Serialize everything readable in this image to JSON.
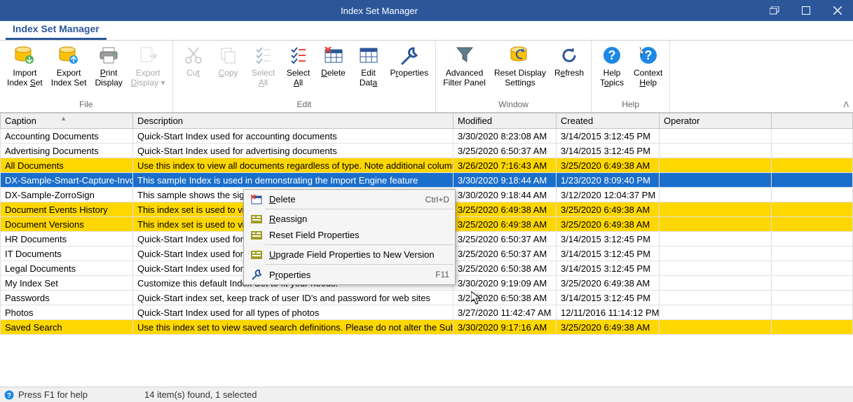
{
  "window": {
    "title": "Index Set Manager"
  },
  "ribbonTab": "Index Set Manager",
  "ribbon": {
    "file": {
      "label": "File",
      "import": "Import\nIndex Set",
      "export": "Export\nIndex Set",
      "print": "Print\nDisplay",
      "exportDisp": "Export\nDisplay ▾"
    },
    "edit": {
      "label": "Edit",
      "cut": "Cut",
      "copy": "Copy",
      "selectAll": "Select\nAll",
      "selectAll2": "Select\nAll",
      "delete": "Delete",
      "editData": "Edit\nData",
      "properties": "Properties"
    },
    "window": {
      "label": "Window",
      "adv": "Advanced\nFilter Panel",
      "reset": "Reset Display\nSettings",
      "refresh": "Refresh"
    },
    "help": {
      "label": "Help",
      "topics": "Help\nTopics",
      "context": "Context\nHelp"
    }
  },
  "columns": {
    "caption": "Caption",
    "description": "Description",
    "modified": "Modified",
    "created": "Created",
    "operator": "Operator"
  },
  "rows": [
    {
      "caption": "Accounting Documents",
      "desc": "Quick-Start Index used for accounting documents",
      "mod": "3/30/2020 8:23:08 AM",
      "created": "3/14/2015 3:12:45 PM",
      "op": "",
      "cls": ""
    },
    {
      "caption": "Advertising Documents",
      "desc": "Quick-Start Index used for advertising documents",
      "mod": "3/25/2020 6:50:37 AM",
      "created": "3/14/2015 3:12:45 PM",
      "op": "",
      "cls": ""
    },
    {
      "caption": "All Documents",
      "desc": "Use this index to view all documents regardless of type. Note additional columns",
      "mod": "3/26/2020 7:16:43 AM",
      "created": "3/25/2020 6:49:38 AM",
      "op": "",
      "cls": "yellow"
    },
    {
      "caption": "DX-Sample-Smart-Capture-Invoice",
      "desc": "This sample Index is used in demonstrating the Import Engine feature",
      "mod": "3/30/2020 9:18:44 AM",
      "created": "1/23/2020 8:09:40 PM",
      "op": "",
      "cls": "selected"
    },
    {
      "caption": "DX-Sample-ZorroSign",
      "desc": "This sample shows the signing integration",
      "mod": "3/30/2020 9:18:44 AM",
      "created": "3/12/2020 12:04:37 PM",
      "op": "",
      "cls": ""
    },
    {
      "caption": "Document Events History",
      "desc": "This index set is used to view document events",
      "mod": "3/25/2020 6:49:38 AM",
      "created": "3/25/2020 6:49:38 AM",
      "op": "",
      "cls": "yellow"
    },
    {
      "caption": "Document Versions",
      "desc": "This index set is used to view document versions",
      "mod": "3/25/2020 6:49:38 AM",
      "created": "3/25/2020 6:49:38 AM",
      "op": "",
      "cls": "yellow"
    },
    {
      "caption": "HR Documents",
      "desc": "Quick-Start Index used for HR documents",
      "mod": "3/25/2020 6:50:37 AM",
      "created": "3/14/2015 3:12:45 PM",
      "op": "",
      "cls": ""
    },
    {
      "caption": "IT Documents",
      "desc": "Quick-Start Index used for IT documents",
      "mod": "3/25/2020 6:50:37 AM",
      "created": "3/14/2015 3:12:45 PM",
      "op": "",
      "cls": ""
    },
    {
      "caption": "Legal Documents",
      "desc": "Quick-Start Index used for legal documents",
      "mod": "3/25/2020 6:50:38 AM",
      "created": "3/14/2015 3:12:45 PM",
      "op": "",
      "cls": ""
    },
    {
      "caption": "My Index Set",
      "desc": "Customize this default Index Set to fit your needs.",
      "mod": "3/30/2020 9:19:09 AM",
      "created": "3/25/2020 6:49:38 AM",
      "op": "",
      "cls": ""
    },
    {
      "caption": "Passwords",
      "desc": "Quick-Start index set, keep track of user ID's and password for web sites",
      "mod": "3/25/2020 6:50:38 AM",
      "created": "3/14/2015 3:12:45 PM",
      "op": "",
      "cls": ""
    },
    {
      "caption": "Photos",
      "desc": "Quick-Start Index used for all types of photos",
      "mod": "3/27/2020 11:42:47 AM",
      "created": "12/11/2016 11:14:12 PM",
      "op": "",
      "cls": ""
    },
    {
      "caption": "Saved Search",
      "desc": "Use this index set to view saved search definitions. Please do not alter the Subject",
      "mod": "3/30/2020 9:17:16 AM",
      "created": "3/25/2020 6:49:38 AM",
      "op": "",
      "cls": "yellow"
    }
  ],
  "contextMenu": {
    "delete": "Delete",
    "deleteKey": "Ctrl+D",
    "reassign": "Reassign",
    "resetField": "Reset Field Properties",
    "upgrade": "Upgrade Field Properties to New Version",
    "properties": "Properties",
    "propKey": "F11"
  },
  "status": {
    "help": "Press F1 for help",
    "count": "14 item(s) found, 1 selected"
  }
}
